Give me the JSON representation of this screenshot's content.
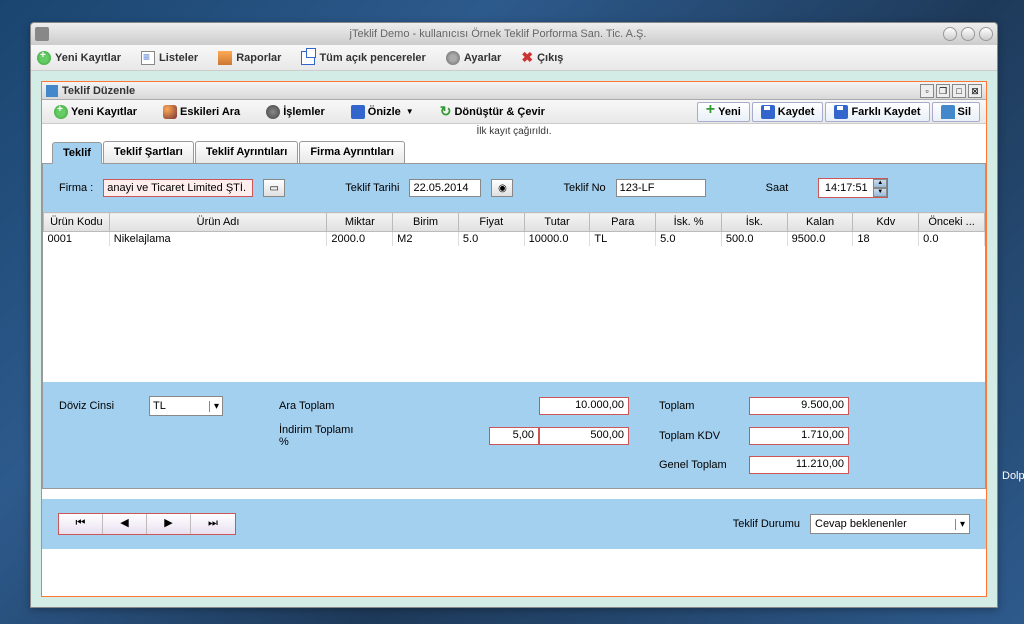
{
  "window": {
    "title": "jTeklif   Demo  -  kullanıcısı   Örnek Teklif Porforma San. Tic. A.Ş."
  },
  "mainToolbar": {
    "yeniKayitlar": "Yeni Kayıtlar",
    "listeler": "Listeler",
    "raporlar": "Raporlar",
    "tumAcik": "Tüm açık pencereler",
    "ayarlar": "Ayarlar",
    "cikis": "Çıkış"
  },
  "inner": {
    "title": "Teklif Düzenle"
  },
  "subToolbar": {
    "yeniKayitlar": "Yeni Kayıtlar",
    "eskileriAra": "Eskileri Ara",
    "islemler": "İşlemler",
    "onizle": "Önizle",
    "donustur": "Dönüştür & Çevir",
    "yeni": "Yeni",
    "kaydet": "Kaydet",
    "farkliKaydet": "Farklı Kaydet",
    "sil": "Sil"
  },
  "statusLine": "İlk kayıt çağırıldı.",
  "tabs": {
    "teklif": "Teklif",
    "sartlari": "Teklif Şartları",
    "ayrintilari": "Teklif Ayrıntıları",
    "firma": "Firma Ayrıntıları"
  },
  "form": {
    "firmaLabel": "Firma :",
    "firmaValue": "anayi ve Ticaret Limited ŞTİ.",
    "tarihLabel": "Teklif Tarihi",
    "tarihValue": "22.05.2014",
    "noLabel": "Teklif No",
    "noValue": "123-LF",
    "saatLabel": "Saat",
    "saatValue": "14:17:51"
  },
  "grid": {
    "headers": {
      "urunKodu": "Ürün Kodu",
      "urunAdi": "Ürün Adı",
      "miktar": "Miktar",
      "birim": "Birim",
      "fiyat": "Fiyat",
      "tutar": "Tutar",
      "para": "Para",
      "iskYuzde": "İsk. %",
      "isk": "İsk.",
      "kalan": "Kalan",
      "kdv": "Kdv",
      "onceki": "Önceki ..."
    },
    "row1": {
      "urunKodu": "0001",
      "urunAdi": "Nikelajlama",
      "miktar": "2000.0",
      "birim": "M2",
      "fiyat": "5.0",
      "tutar": "10000.0",
      "para": "TL",
      "iskYuzde": "5.0",
      "isk": "500.0",
      "kalan": "9500.0",
      "kdv": "18",
      "onceki": "0.0"
    }
  },
  "totals": {
    "dovizLabel": "Döviz Cinsi",
    "dovizValue": "TL",
    "araToplamLabel": "Ara Toplam",
    "araToplamValue": "10.000,00",
    "indirimLabel": "İndirim Toplamı  %",
    "indirimYuzde": "5,00",
    "indirimValue": "500,00",
    "toplamLabel": "Toplam",
    "toplamValue": "9.500,00",
    "kdvLabel": "Toplam KDV",
    "kdvValue": "1.710,00",
    "genelLabel": "Genel Toplam",
    "genelValue": "11.210,00"
  },
  "footer": {
    "durumLabel": "Teklif Durumu",
    "durumValue": "Cevap beklenenler"
  },
  "desktop": {
    "dolp": "Dolp"
  }
}
